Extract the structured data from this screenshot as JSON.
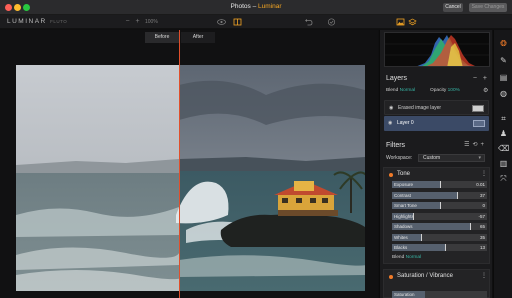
{
  "window": {
    "title_prefix": "Photos",
    "title_separator": " – ",
    "title_app": "Luminar",
    "cancel_label": "Cancel",
    "save_label": "Save Changes"
  },
  "toolbar": {
    "logo": "LUMINAR",
    "logo_flavor": "FLUTO",
    "zoom_minus": "−",
    "zoom_plus": "+",
    "zoom_value": "100%"
  },
  "compare": {
    "before_label": "Before",
    "after_label": "After"
  },
  "layers": {
    "heading": "Layers",
    "blend_label": "Blend",
    "blend_value": "Normal",
    "opacity_label": "Opacity",
    "opacity_value": "100%",
    "items": [
      {
        "label": "Erased image layer"
      },
      {
        "label": "Layer 0"
      }
    ]
  },
  "filters": {
    "heading": "Filters",
    "workspace_label": "Workspace:",
    "workspace_value": "Custom",
    "tone": {
      "title": "Tone",
      "sliders": [
        {
          "label": "Exposure",
          "value": "0.01",
          "fraction": 0.5
        },
        {
          "label": "Contrast",
          "value": "37",
          "fraction": 0.68
        },
        {
          "label": "Smart Tone",
          "value": "0",
          "fraction": 0.5
        },
        {
          "label": "Highlights",
          "value": "-57",
          "fraction": 0.22
        },
        {
          "label": "Shadows",
          "value": "65",
          "fraction": 0.82
        },
        {
          "label": "Whites",
          "value": "35",
          "fraction": 0.3
        },
        {
          "label": "Blacks",
          "value": "13",
          "fraction": 0.56
        }
      ],
      "blend_label": "Blend",
      "blend_value": "Normal"
    },
    "saturation": {
      "title": "Saturation / Vibrance",
      "first_slider_label": "Saturation",
      "first_slider_fraction": 0.35
    }
  },
  "colors": {
    "accent_orange": "#f5a623",
    "split_line": "#e04f2b",
    "teal": "#38b6a6",
    "layer_selected": "#3b4a66"
  },
  "tools": [
    "palette-icon",
    "brush-icon",
    "layers-stack-icon",
    "radial-icon",
    "crop-icon",
    "clone-stamp-icon",
    "eraser-icon",
    "gradient-icon",
    "transform-icon"
  ]
}
